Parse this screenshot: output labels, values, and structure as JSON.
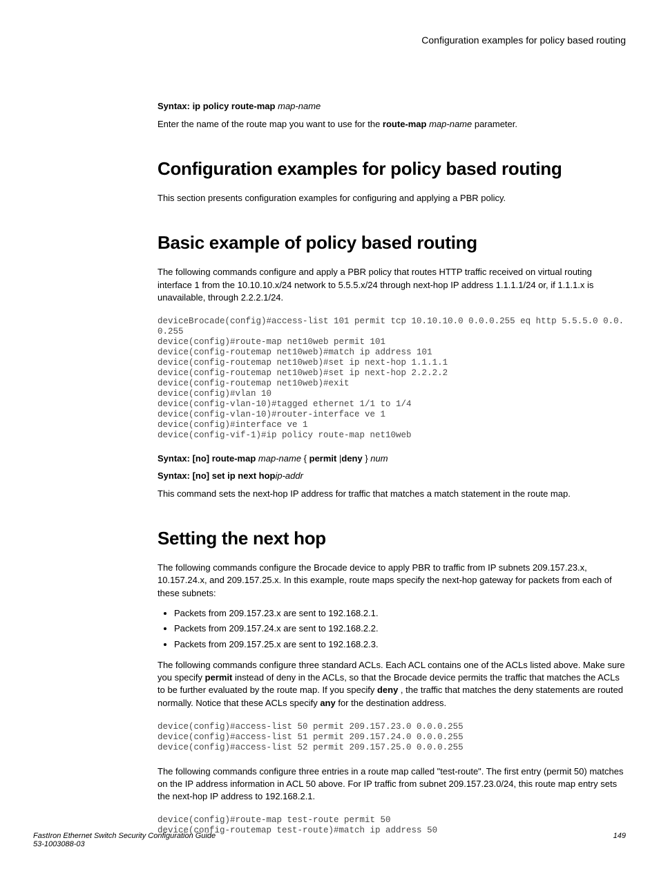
{
  "header": {
    "title": "Configuration examples for policy based routing"
  },
  "syntax1": {
    "label": "Syntax: ip policy route-map",
    "arg": "map-name"
  },
  "intro_para": {
    "pre": "Enter the name of the route map you want to use for the ",
    "bold": "route-map",
    "italic": " map-name",
    "post": " parameter."
  },
  "section1": {
    "heading": "Configuration examples for policy based routing",
    "para": "This section presents configuration examples for configuring and applying a PBR policy."
  },
  "section2": {
    "heading": "Basic example of policy based routing",
    "para": "The following commands configure and apply a PBR policy that routes HTTP traffic received on virtual routing interface 1 from the 10.10.10.x/24 network to 5.5.5.x/24 through next-hop IP address 1.1.1.1/24 or, if 1.1.1.x is unavailable, through 2.2.2.1/24.",
    "code": "deviceBrocade(config)#access-list 101 permit tcp 10.10.10.0 0.0.0.255 eq http 5.5.5.0 0.0.0.255\ndevice(config)#route-map net10web permit 101\ndevice(config-routemap net10web)#match ip address 101\ndevice(config-routemap net10web)#set ip next-hop 1.1.1.1\ndevice(config-routemap net10web)#set ip next-hop 2.2.2.2\ndevice(config-routemap net10web)#exit\ndevice(config)#vlan 10\ndevice(config-vlan-10)#tagged ethernet 1/1 to 1/4\ndevice(config-vlan-10)#router-interface ve 1\ndevice(config)#interface ve 1\ndevice(config-vif-1)#ip policy route-map net10web"
  },
  "syntax2": {
    "prefix": "Syntax: [no] route-map",
    "mapname": " map-name ",
    "brace_open": "{ ",
    "permit": "permit",
    "pipe": " |",
    "deny": "deny",
    "brace_close": " } ",
    "num": "num"
  },
  "syntax3": {
    "prefix": "Syntax: [no] set ip next hop",
    "arg": "ip-addr"
  },
  "after_syntax_para": "This command sets the next-hop IP address for traffic that matches a match statement in the route map.",
  "section3": {
    "heading": "Setting the next hop",
    "para1": "The following commands configure the Brocade device to apply PBR to traffic from IP subnets 209.157.23.x, 10.157.24.x, and 209.157.25.x. In this example, route maps specify the next-hop gateway for packets from each of these subnets:",
    "bullets": [
      "Packets from 209.157.23.x are sent to 192.168.2.1.",
      "Packets from 209.157.24.x are sent to 192.168.2.2.",
      "Packets from 209.157.25.x are sent to 192.168.2.3."
    ],
    "para2_a": "The following commands configure three standard ACLs. Each ACL contains one of the ACLs listed above. Make sure you specify ",
    "para2_permit": "permit",
    "para2_b": " instead of deny in the ACLs, so that the Brocade device permits the traffic that matches the ACLs to be further evaluated by the route map. If you specify ",
    "para2_deny": "deny",
    "para2_c": " , the traffic that matches the deny statements are routed normally. Notice that these ACLs specify ",
    "para2_any": "any",
    "para2_d": " for the destination address.",
    "code1": "device(config)#access-list 50 permit 209.157.23.0 0.0.0.255\ndevice(config)#access-list 51 permit 209.157.24.0 0.0.0.255\ndevice(config)#access-list 52 permit 209.157.25.0 0.0.0.255",
    "para3": "The following commands configure three entries in a route map called \"test-route\". The first entry (permit 50) matches on the IP address information in ACL 50 above. For IP traffic from subnet 209.157.23.0/24, this route map entry sets the next-hop IP address to 192.168.2.1.",
    "code2": "device(config)#route-map test-route permit 50\ndevice(config-routemap test-route)#match ip address 50"
  },
  "footer": {
    "line1": "FastIron Ethernet Switch Security Configuration Guide",
    "line2": "53-1003088-03",
    "page": "149"
  }
}
